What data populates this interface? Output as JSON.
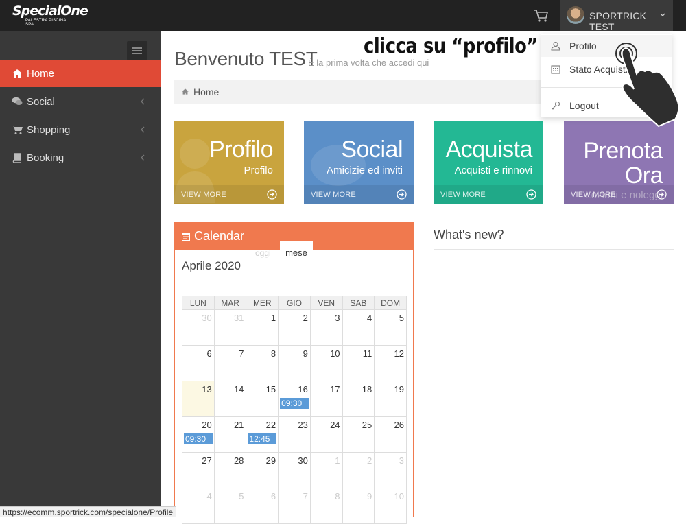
{
  "topbar": {
    "logo_text": "SpecialOne",
    "logo_subtitle": "PALESTRA PISCINA SPA",
    "cart_icon": "cart-icon",
    "user_name": "SPORTRICK TEST"
  },
  "sidebar": {
    "items": [
      {
        "label": "Home",
        "icon": "home-icon",
        "active": true
      },
      {
        "label": "Social",
        "icon": "comments-icon"
      },
      {
        "label": "Shopping",
        "icon": "cart-icon"
      },
      {
        "label": "Booking",
        "icon": "book-icon"
      }
    ]
  },
  "main": {
    "welcome": "Benvenuto TEST",
    "welcome_sub": "È la prima volta che accedi qui",
    "breadcrumb": "Home"
  },
  "tiles": [
    {
      "title": "Profilo",
      "subtitle": "Profilo",
      "more": "VIEW MORE",
      "color": "#c9a43e"
    },
    {
      "title": "Social",
      "subtitle": "Amicizie ed inviti",
      "more": "VIEW MORE",
      "color": "#5b8fc8"
    },
    {
      "title": "Acquista",
      "subtitle": "Acquisti e rinnovi",
      "more": "VIEW MORE",
      "color": "#23b894"
    },
    {
      "title": "Prenota Ora",
      "subtitle": "Lezioni e noleggi",
      "more": "VIEW MORE",
      "color": "#8e76b3"
    }
  ],
  "calendar": {
    "title": "Calendar",
    "tab_today": "oggi",
    "tab_month": "mese",
    "month_label": "Aprile 2020",
    "weekdays": [
      "LUN",
      "MAR",
      "MER",
      "GIO",
      "VEN",
      "SAB",
      "DOM"
    ],
    "weeks": [
      [
        {
          "d": "30",
          "o": true
        },
        {
          "d": "31",
          "o": true
        },
        {
          "d": "1"
        },
        {
          "d": "2"
        },
        {
          "d": "3"
        },
        {
          "d": "4"
        },
        {
          "d": "5"
        }
      ],
      [
        {
          "d": "6"
        },
        {
          "d": "7"
        },
        {
          "d": "8"
        },
        {
          "d": "9"
        },
        {
          "d": "10"
        },
        {
          "d": "11"
        },
        {
          "d": "12"
        }
      ],
      [
        {
          "d": "13",
          "today": true
        },
        {
          "d": "14"
        },
        {
          "d": "15"
        },
        {
          "d": "16",
          "ev": "09:30"
        },
        {
          "d": "17"
        },
        {
          "d": "18"
        },
        {
          "d": "19"
        }
      ],
      [
        {
          "d": "20",
          "ev": "09:30"
        },
        {
          "d": "21"
        },
        {
          "d": "22",
          "ev": "12:45"
        },
        {
          "d": "23"
        },
        {
          "d": "24"
        },
        {
          "d": "25"
        },
        {
          "d": "26"
        }
      ],
      [
        {
          "d": "27"
        },
        {
          "d": "28"
        },
        {
          "d": "29"
        },
        {
          "d": "30"
        },
        {
          "d": "1",
          "o": true
        },
        {
          "d": "2",
          "o": true
        },
        {
          "d": "3",
          "o": true
        }
      ],
      [
        {
          "d": "4",
          "o": true
        },
        {
          "d": "5",
          "o": true
        },
        {
          "d": "6",
          "o": true
        },
        {
          "d": "7",
          "o": true
        },
        {
          "d": "8",
          "o": true
        },
        {
          "d": "9",
          "o": true
        },
        {
          "d": "10",
          "o": true
        }
      ]
    ]
  },
  "news": {
    "title": "What's new?"
  },
  "dropdown": {
    "items": [
      {
        "label": "Profilo",
        "icon": "user-icon"
      },
      {
        "label": "Stato Acquisti",
        "icon": "calendar-icon"
      },
      {
        "label": "Logout",
        "icon": "key-icon"
      }
    ]
  },
  "annotation": "clicca su “profilo”",
  "status_url": "https://ecomm.sportrick.com/specialone/Profile",
  "colors": {
    "topbar": "#222222",
    "sidebar": "#393939",
    "active": "#e04a36",
    "calendar": "#f0794e",
    "event": "#5b9bd8"
  }
}
